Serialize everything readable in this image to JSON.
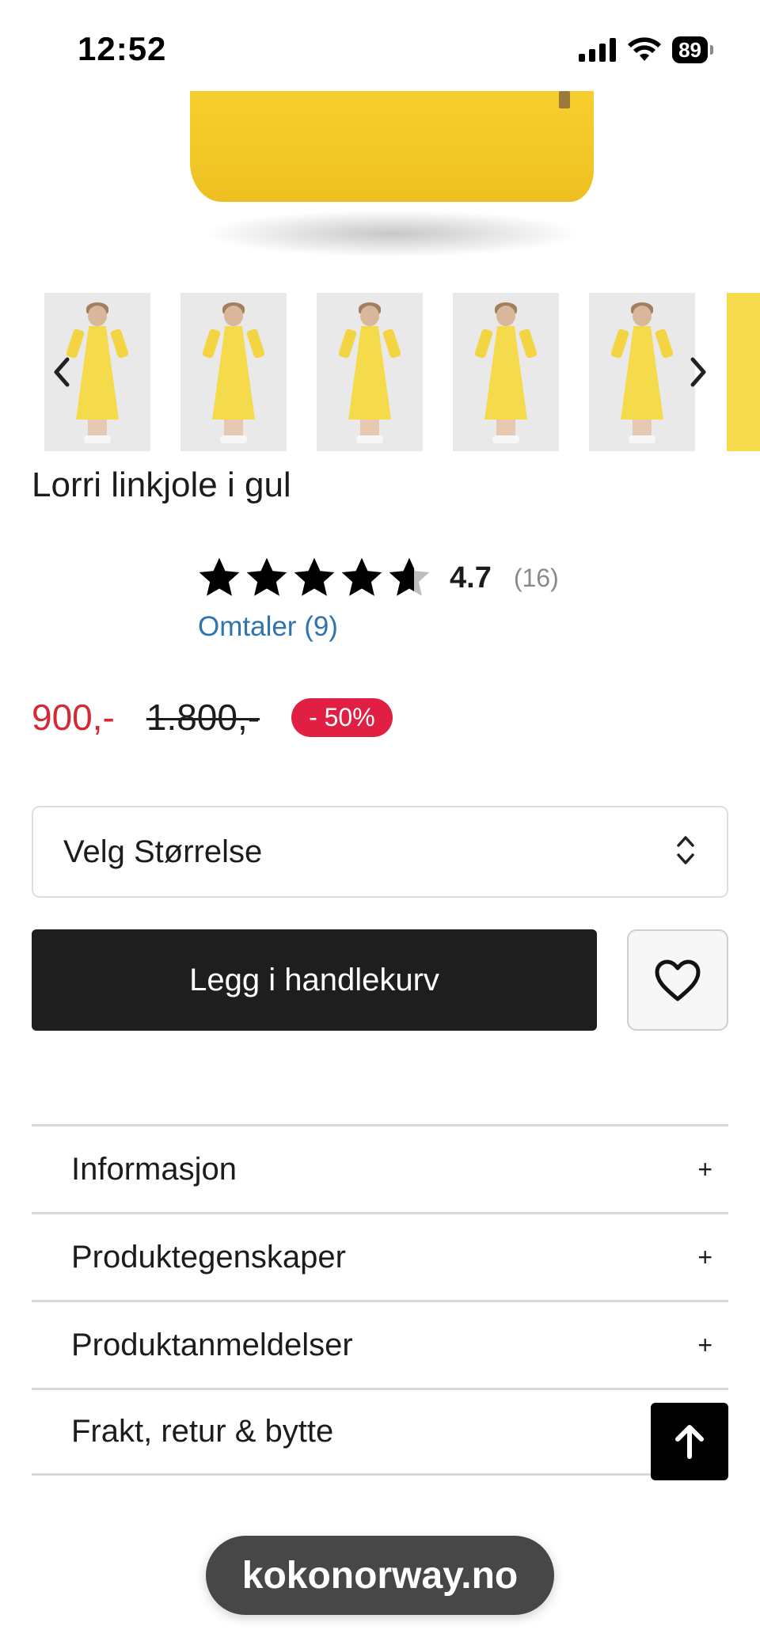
{
  "status_bar": {
    "time": "12:52",
    "battery": "89"
  },
  "gallery": {
    "thumbnail_count": 6,
    "prev_icon": "chevron-left-icon",
    "next_icon": "chevron-right-icon"
  },
  "product": {
    "title": "Lorri linkjole i gul",
    "rating": {
      "value": "4.7",
      "count": "(16)",
      "stars_filled": 4.7,
      "stars_total": 5,
      "reviews_link": "Omtaler (9)"
    },
    "price": {
      "current": "900,-",
      "original": "1.800,-",
      "discount": "- 50%"
    },
    "size_select": {
      "label": "Velg Størrelse",
      "icon": "chevron-updown-icon"
    },
    "add_to_cart": "Legg i handlekurv",
    "wishlist_icon": "heart-icon"
  },
  "accordion": [
    {
      "label": "Informasjon",
      "toggle": "+"
    },
    {
      "label": "Produktegenskaper",
      "toggle": "+"
    },
    {
      "label": "Produktanmeldelser",
      "toggle": "+"
    },
    {
      "label": "Frakt, retur & bytte",
      "toggle": ""
    }
  ],
  "browser": {
    "url": "kokonorway.no"
  },
  "colors": {
    "accent_price": "#d52a36",
    "discount_badge": "#e01f43",
    "link": "#2f74ad",
    "button_dark": "#1e1e1e",
    "dress_yellow": "#f5da4b"
  }
}
